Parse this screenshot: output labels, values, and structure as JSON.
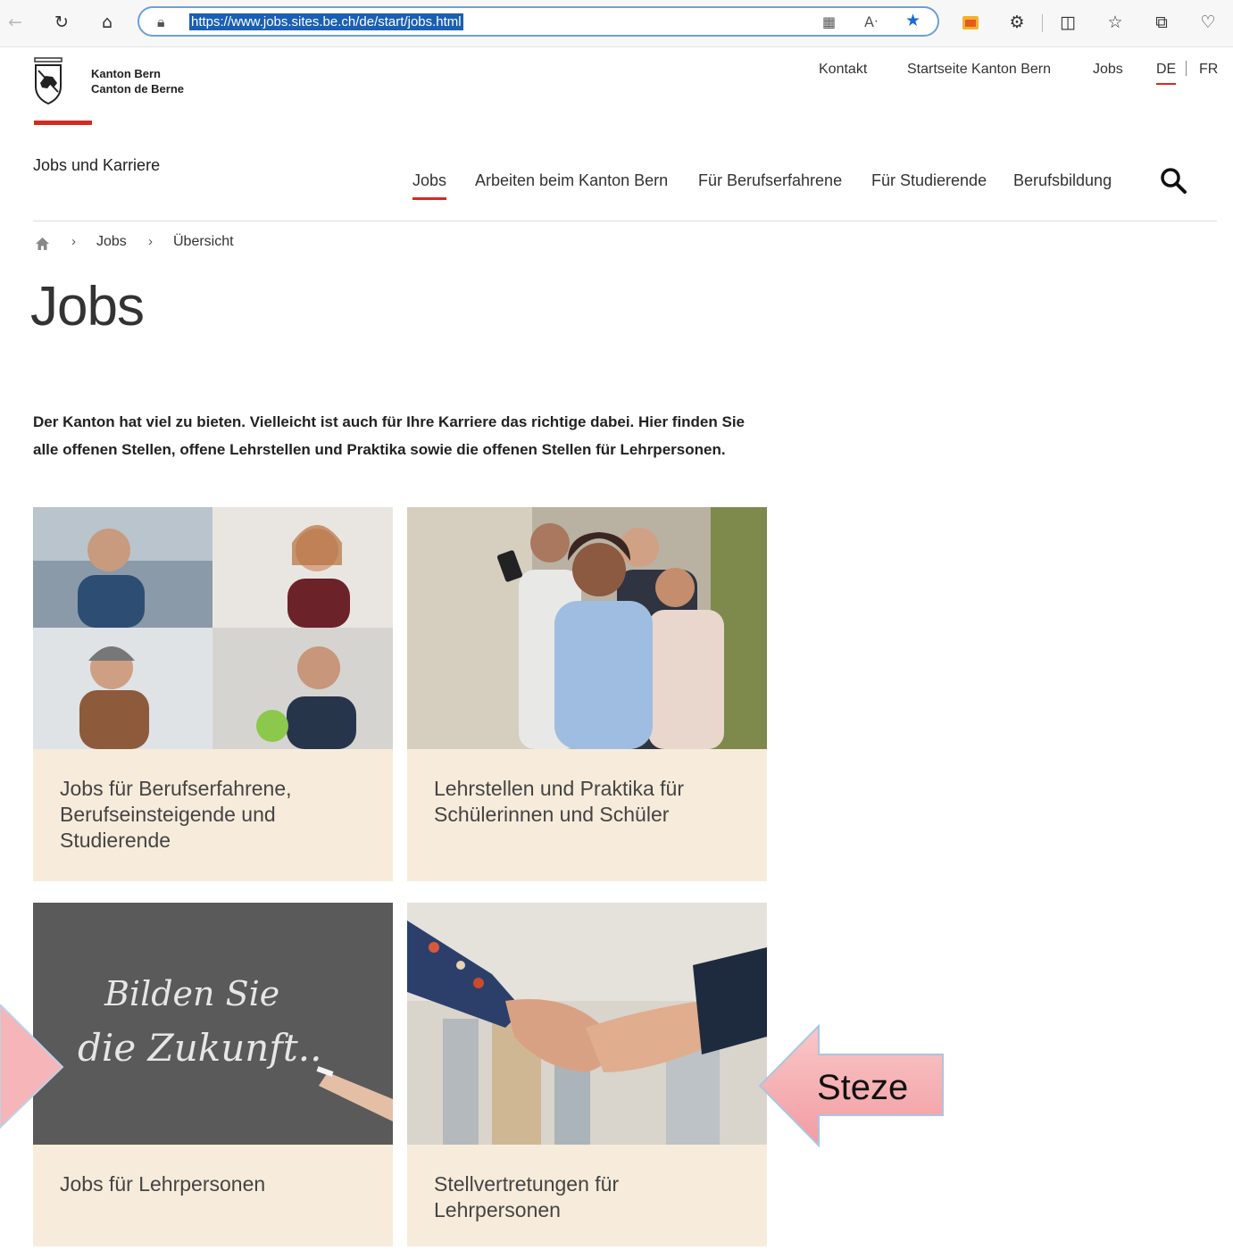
{
  "browser": {
    "url": "https://www.jobs.sites.be.ch/de/start/jobs.html",
    "read_aloud_label": "A"
  },
  "header": {
    "logo_line1": "Kanton Bern",
    "logo_line2": "Canton de Berne",
    "service_nav": [
      "Kontakt",
      "Startseite Kanton Bern",
      "Jobs"
    ],
    "lang_de": "DE",
    "lang_fr": "FR",
    "site_title": "Jobs und Karriere",
    "main_nav": [
      "Jobs",
      "Arbeiten beim Kanton Bern",
      "Für Berufserfahrene",
      "Für Studierende",
      "Berufsbildung"
    ]
  },
  "breadcrumb": {
    "items": [
      "Jobs",
      "Übersicht"
    ]
  },
  "page": {
    "title": "Jobs",
    "intro": "Der Kanton hat viel zu bieten. Vielleicht ist auch für Ihre Karriere das richtige dabei. Hier finden Sie alle offenen Stellen, offene Lehrstellen und Praktika sowie die offenen Stellen für Lehrpersonen."
  },
  "tiles": [
    {
      "caption": "Jobs für Berufserfahrene, Berufseinsteigende und Studierende"
    },
    {
      "caption": "Lehrstellen und Praktika für Schülerinnen und Schüler"
    },
    {
      "caption": "Jobs für Lehrpersonen",
      "chalk_line1": "Bilden Sie",
      "chalk_line2": "die Zukunft.."
    },
    {
      "caption": "Stellvertretungen für Lehrpersonen"
    }
  ],
  "annotations": {
    "right_label": "Steze",
    "left_label": ""
  },
  "colors": {
    "accent_red": "#d52b1e",
    "tile_bg": "#f7ecdb",
    "callout_pink": "#f6b5b8"
  }
}
